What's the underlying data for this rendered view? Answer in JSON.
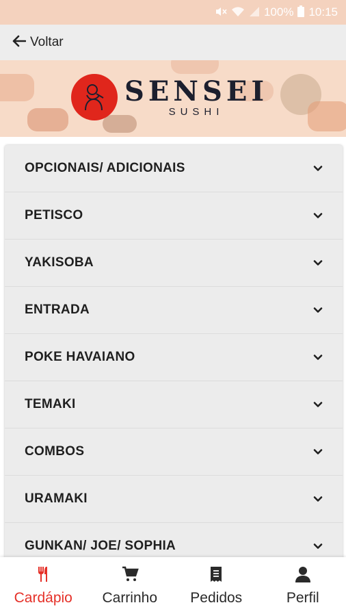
{
  "status_bar": {
    "battery": "100%",
    "time": "10:15",
    "icons": [
      "mute-icon",
      "wifi-icon",
      "signal-icon",
      "battery-icon"
    ]
  },
  "topnav": {
    "back_label": "Voltar",
    "back_icon": "arrow-left-icon"
  },
  "banner": {
    "brand": "SENSEI",
    "brand_sub": "SUSHI",
    "logo_icon": "samurai-logo-icon",
    "brand_color": "#e0261c"
  },
  "menu": {
    "categories": [
      {
        "label": "OPCIONAIS/ ADICIONAIS"
      },
      {
        "label": "PETISCO"
      },
      {
        "label": "YAKISOBA"
      },
      {
        "label": "ENTRADA"
      },
      {
        "label": "POKE HAVAIANO"
      },
      {
        "label": "TEMAKI"
      },
      {
        "label": "COMBOS"
      },
      {
        "label": "URAMAKI"
      },
      {
        "label": "GUNKAN/ JOE/ SOPHIA"
      }
    ]
  },
  "bottom_nav": {
    "items": [
      {
        "label": "Cardápio",
        "icon": "fork-knife-icon",
        "active": true
      },
      {
        "label": "Carrinho",
        "icon": "cart-icon",
        "active": false
      },
      {
        "label": "Pedidos",
        "icon": "receipt-icon",
        "active": false
      },
      {
        "label": "Perfil",
        "icon": "user-icon",
        "active": false
      }
    ],
    "active_color": "#e53028"
  }
}
